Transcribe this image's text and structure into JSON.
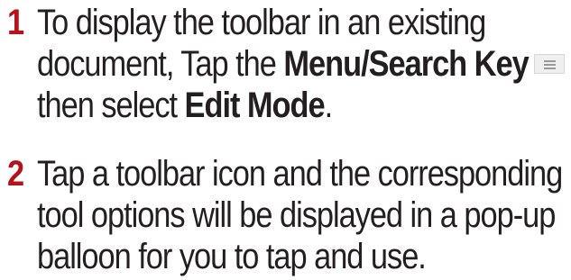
{
  "steps": [
    {
      "number": "1",
      "line1": "To display the toolbar in an existing",
      "line2_prefix": "document, Tap the ",
      "line2_bold": "Menu/Search Key",
      "menu_icon": "menu-lines-icon",
      "line3_prefix": "then select ",
      "line3_bold": "Edit Mode",
      "line3_suffix": "."
    },
    {
      "number": "2",
      "line1": "Tap a toolbar icon and the corresponding",
      "line2": "tool options will be displayed in a pop-up",
      "line3": "balloon for you to tap and use."
    }
  ],
  "colors": {
    "step_number": "#b5121b",
    "text": "#231f20",
    "icon_bg": "#f0eff0",
    "icon_lines": "#9a999a"
  }
}
